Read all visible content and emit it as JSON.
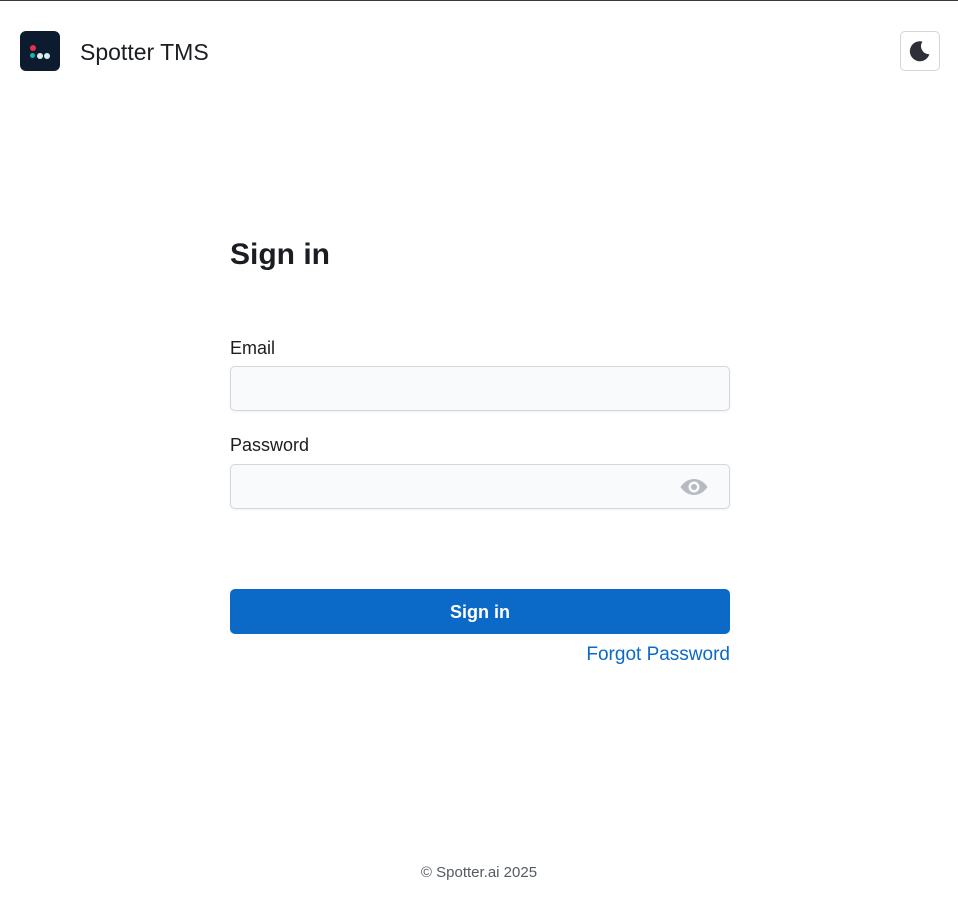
{
  "app": {
    "title": "Spotter TMS",
    "logo_icon": "spotter-logo-icon",
    "theme_toggle_icon": "moon-icon"
  },
  "form": {
    "title": "Sign in",
    "email_label": "Email",
    "email_value": "",
    "email_placeholder": "",
    "password_label": "Password",
    "password_value": "",
    "password_placeholder": "",
    "password_visibility_icon": "eye-icon",
    "submit_label": "Sign in",
    "forgot_label": "Forgot Password"
  },
  "footer": {
    "copyright": "© Spotter.ai 2025"
  },
  "colors": {
    "accent": "#0b69c7",
    "logo_bg": "#0d1b2e",
    "logo_dot_red": "#e8304a",
    "logo_dot_teal": "#17b5a8",
    "logo_dot_light": "#d9ecf2"
  }
}
